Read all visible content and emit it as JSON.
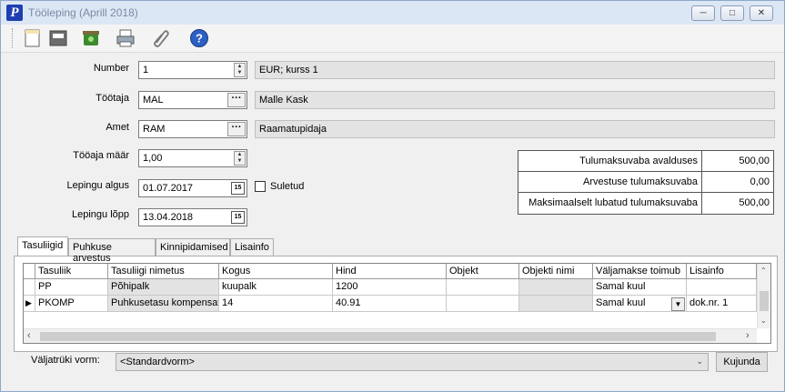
{
  "window": {
    "title": "Tööleping (Aprill 2018)",
    "app_icon": "P"
  },
  "toolbar": {
    "icons": [
      "new-document-icon",
      "save-icon",
      "delete-icon",
      "print-icon",
      "attachment-icon",
      "help-icon"
    ]
  },
  "form": {
    "number_label": "Number",
    "number_value": "1",
    "currency_text": "EUR; kurss 1",
    "employee_label": "Töötaja",
    "employee_code": "MAL",
    "employee_name": "Malle Kask",
    "position_label": "Amet",
    "position_code": "RAM",
    "position_name": "Raamatupidaja",
    "workload_label": "Tööaja määr",
    "workload_value": "1,00",
    "start_label": "Lepingu algus",
    "start_value": "01.07.2017",
    "closed_label": "Suletud",
    "end_label": "Lepingu lõpp",
    "end_value": "13.04.2018"
  },
  "summary": {
    "rows": [
      {
        "label": "Tulumaksuvaba avalduses",
        "value": "500,00"
      },
      {
        "label": "Arvestuse tulumaksuvaba",
        "value": "0,00"
      },
      {
        "label": "Maksimaalselt lubatud tulumaksuvaba",
        "value": "500,00"
      }
    ]
  },
  "tabs": [
    "Tasuliigid",
    "Puhkuse arvestus",
    "Kinnipidamised",
    "Lisainfo"
  ],
  "grid": {
    "headers": [
      "Tasuliik",
      "Tasuliigi nimetus",
      "Kogus",
      "Hind",
      "Objekt",
      "Objekti nimi",
      "Väljamakse toimub",
      "Lisainfo"
    ],
    "rows": [
      [
        "PP",
        "Põhipalk",
        "kuupalk",
        "1200",
        "",
        "",
        "Samal kuul",
        ""
      ],
      [
        "PKOMP",
        "Puhkusetasu kompensat",
        "14",
        "40.91",
        "",
        "",
        "Samal kuul",
        "dok.nr. 1"
      ]
    ]
  },
  "footer": {
    "form_label": "Väljatrüki vorm:",
    "form_value": "<Standardvorm>",
    "layout_button": "Kujunda"
  }
}
